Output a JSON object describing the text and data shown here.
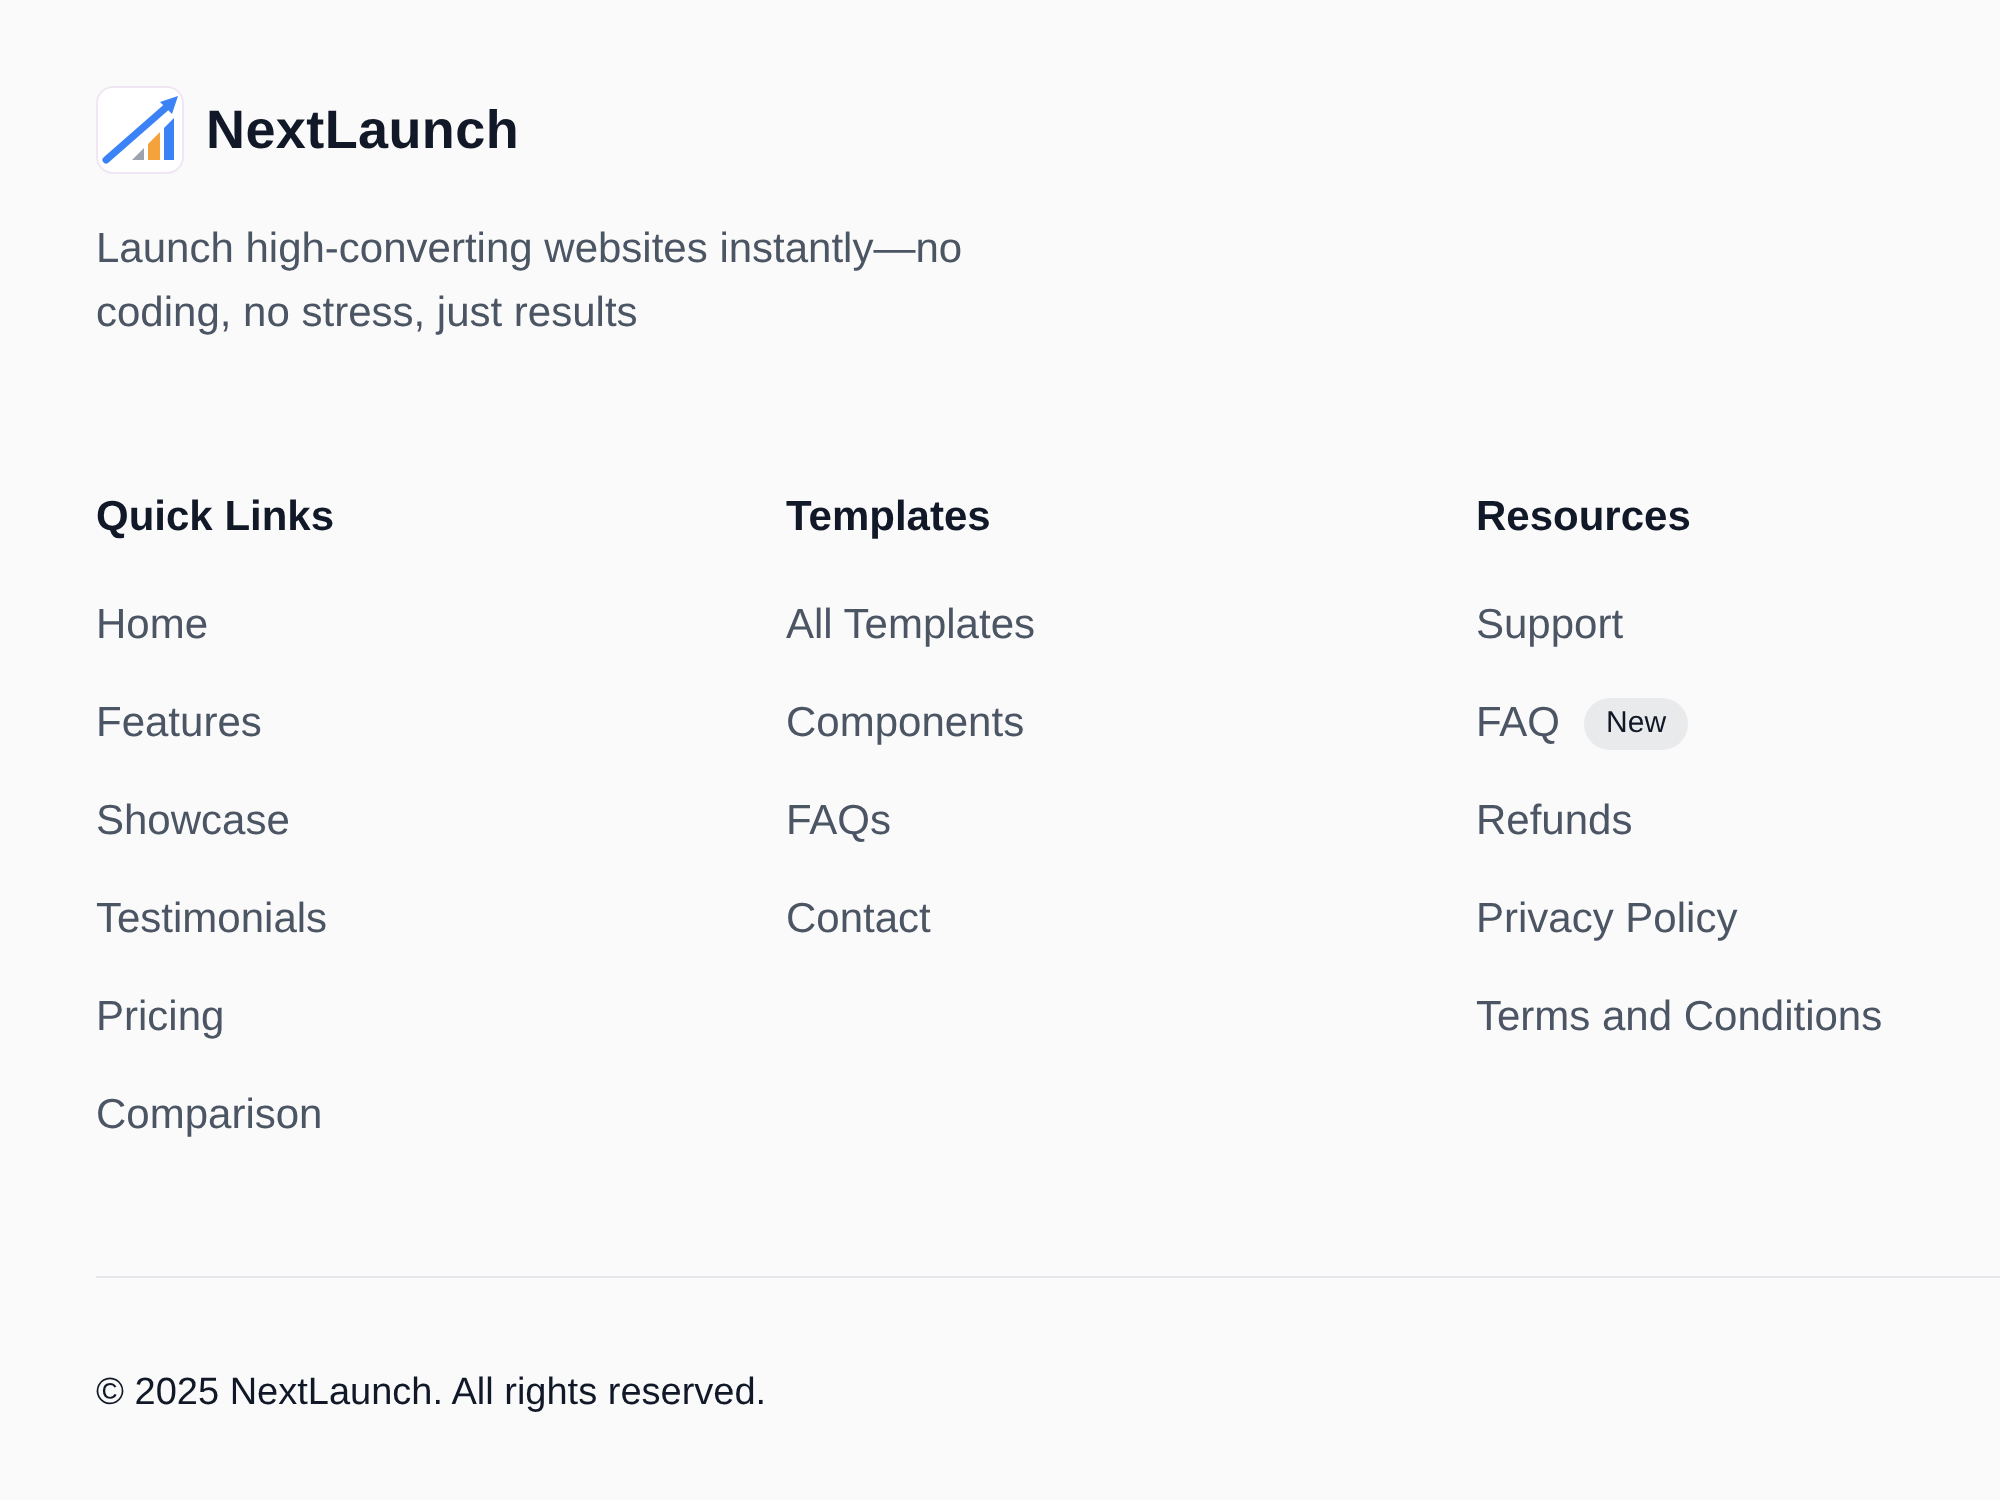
{
  "brand": {
    "name": "NextLaunch",
    "tagline": "Launch high-converting websites instantly—no coding, no stress, just results"
  },
  "columns": [
    {
      "heading": "Quick Links",
      "links": [
        {
          "label": "Home"
        },
        {
          "label": "Features"
        },
        {
          "label": "Showcase"
        },
        {
          "label": "Testimonials"
        },
        {
          "label": "Pricing"
        },
        {
          "label": "Comparison"
        }
      ]
    },
    {
      "heading": "Templates",
      "links": [
        {
          "label": "All Templates"
        },
        {
          "label": "Components"
        },
        {
          "label": "FAQs"
        },
        {
          "label": "Contact"
        }
      ]
    },
    {
      "heading": "Resources",
      "links": [
        {
          "label": "Support"
        },
        {
          "label": "FAQ",
          "badge": "New"
        },
        {
          "label": "Refunds"
        },
        {
          "label": "Privacy Policy"
        },
        {
          "label": "Terms and Conditions"
        }
      ]
    }
  ],
  "footer": {
    "copyright": "© 2025 NextLaunch. All rights reserved."
  }
}
